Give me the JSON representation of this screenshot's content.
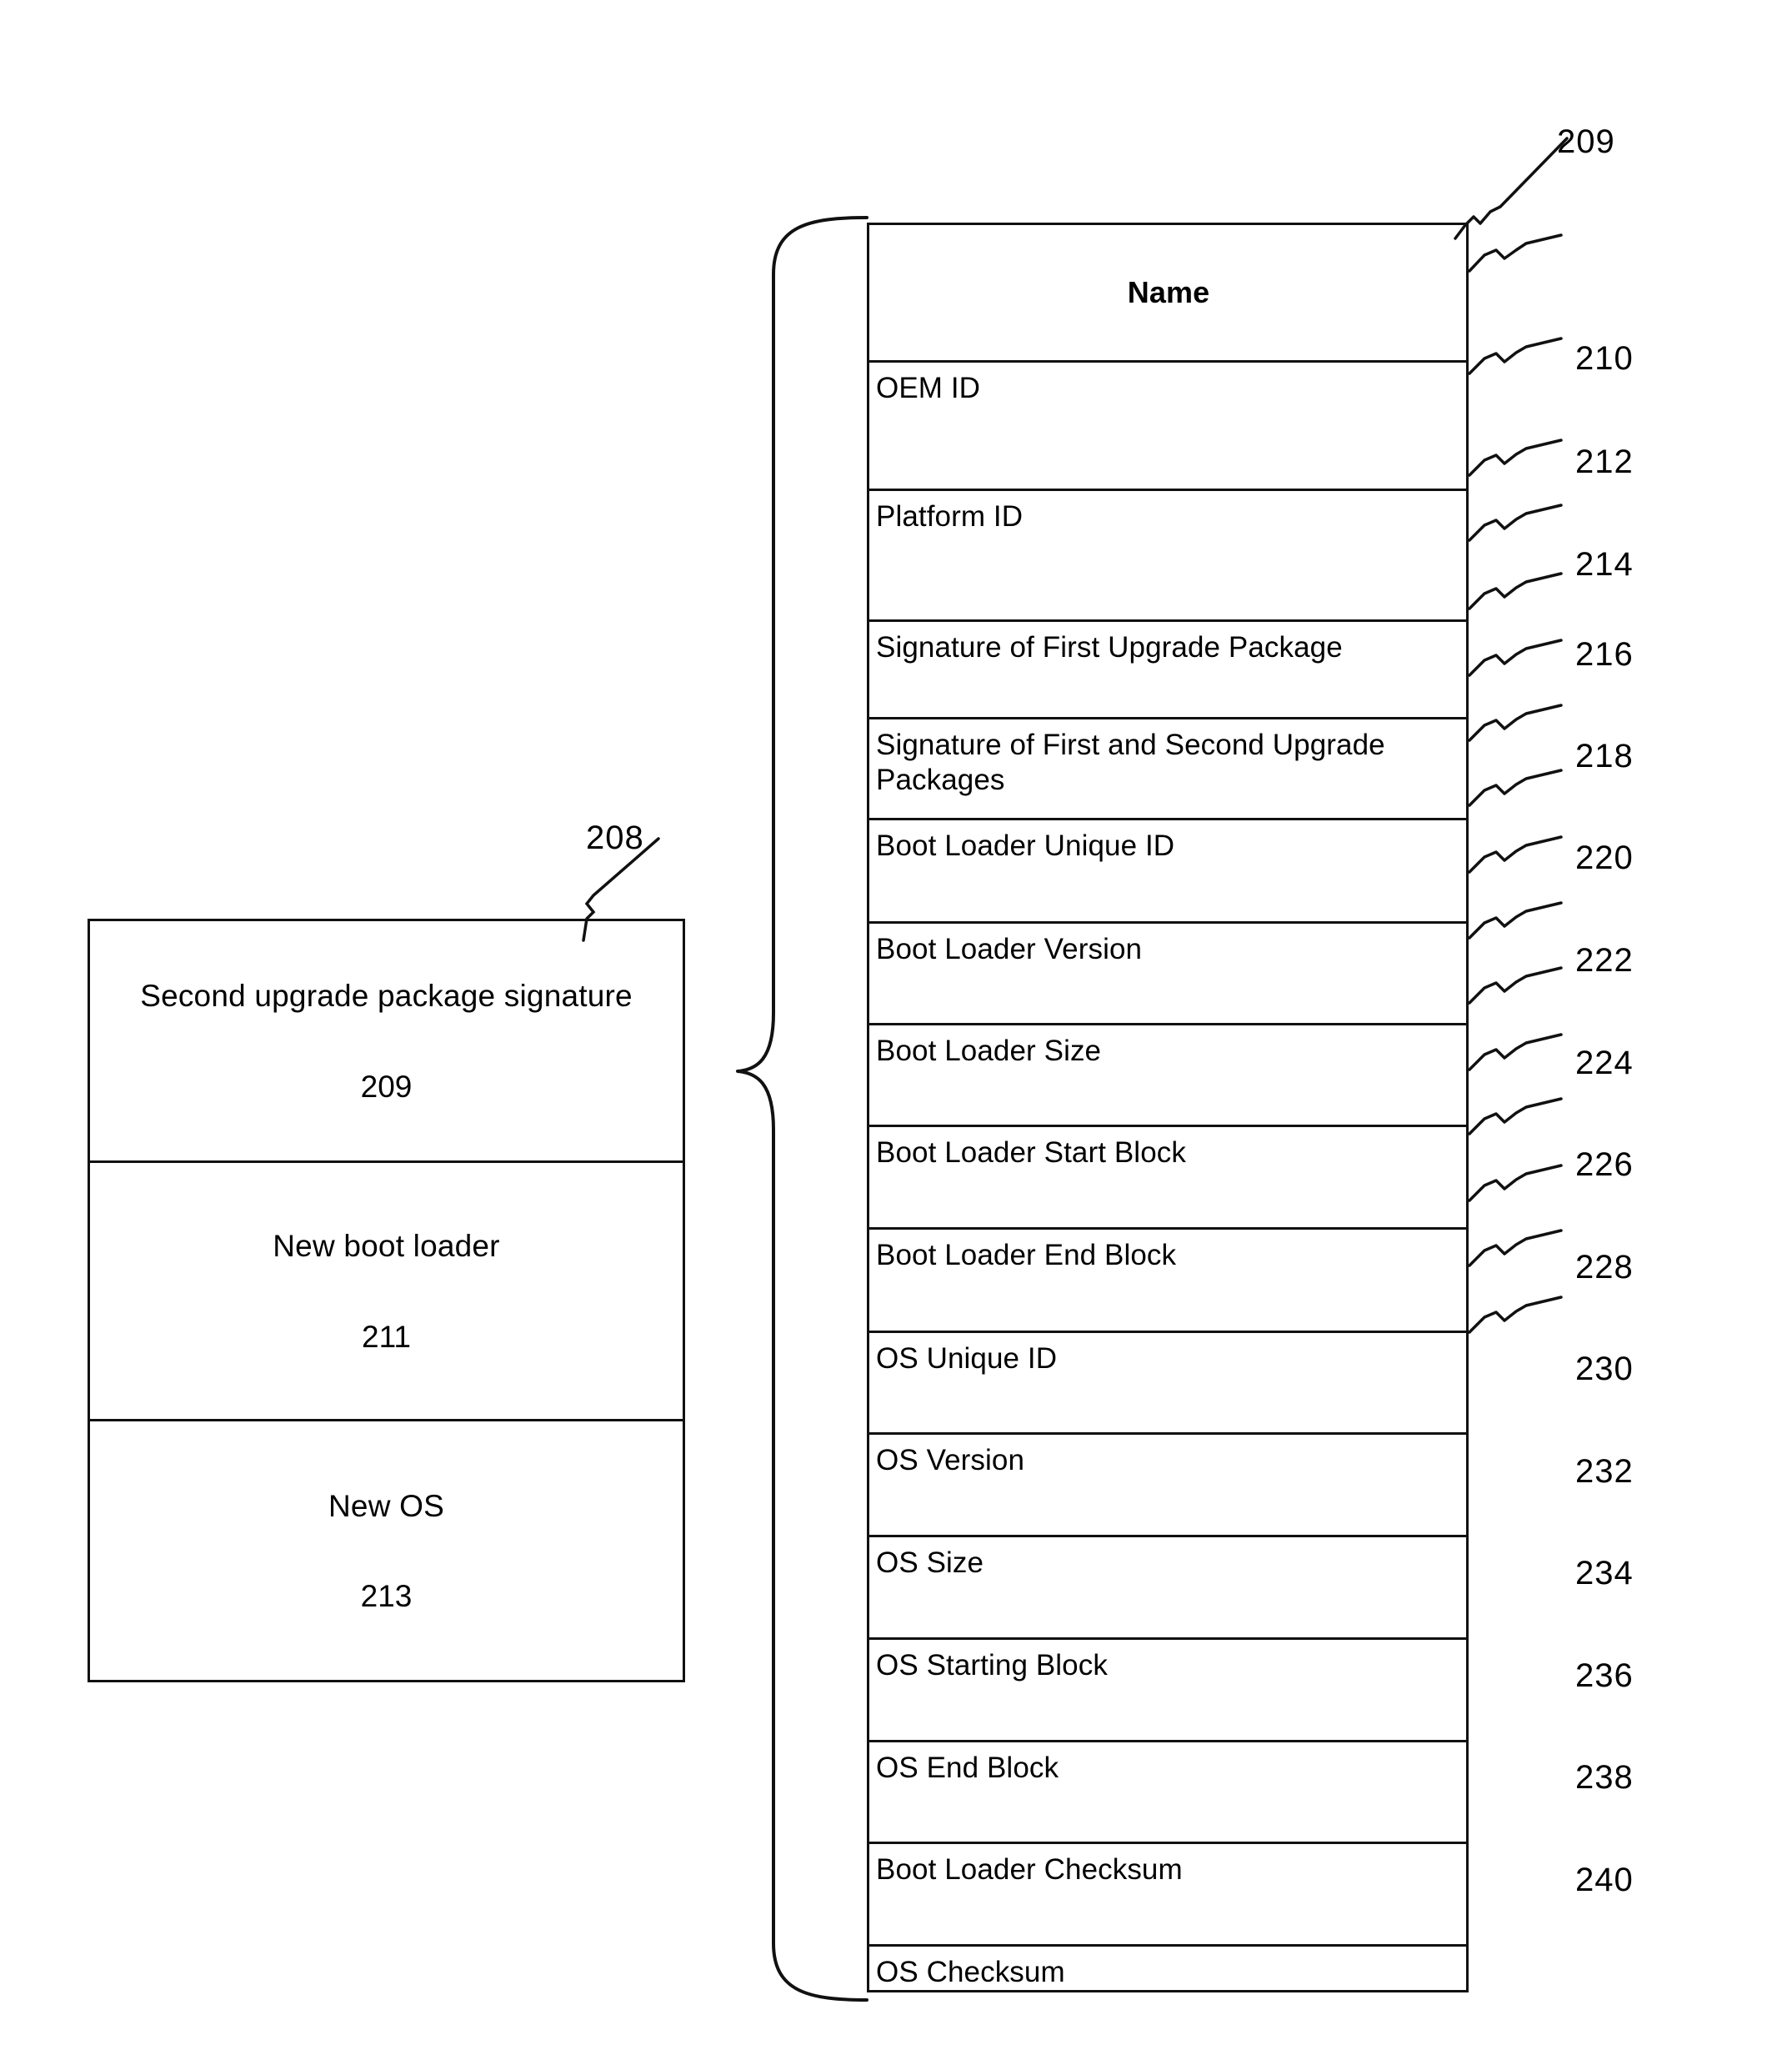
{
  "figure": {
    "package_box": {
      "ref": "208",
      "cells": [
        {
          "title": "Second upgrade package signature",
          "ref": "209"
        },
        {
          "title": "New boot loader",
          "ref": "211"
        },
        {
          "title": "New OS",
          "ref": "213"
        }
      ]
    },
    "metadata_table": {
      "ref": "209",
      "header": "Name",
      "rows": [
        {
          "name": "OEM ID",
          "ref": "210"
        },
        {
          "name": "Platform ID",
          "ref": "212"
        },
        {
          "name": "Signature of First Upgrade Package",
          "ref": "214"
        },
        {
          "name": "Signature of First and Second Upgrade Packages",
          "ref": "216"
        },
        {
          "name": "Boot Loader Unique ID",
          "ref": "218"
        },
        {
          "name": "Boot Loader Version",
          "ref": "220"
        },
        {
          "name": "Boot Loader Size",
          "ref": "222"
        },
        {
          "name": "Boot Loader Start Block",
          "ref": "224"
        },
        {
          "name": "Boot Loader End Block",
          "ref": "226"
        },
        {
          "name": "OS Unique ID",
          "ref": "228"
        },
        {
          "name": "OS Version",
          "ref": "230"
        },
        {
          "name": "OS Size",
          "ref": "232"
        },
        {
          "name": "OS Starting Block",
          "ref": "234"
        },
        {
          "name": "OS End Block",
          "ref": "236"
        },
        {
          "name": "Boot Loader Checksum",
          "ref": "238"
        },
        {
          "name": "OS Checksum",
          "ref": "240"
        }
      ]
    },
    "colors": {
      "line": "#111111",
      "background": "#ffffff",
      "text": "#000000"
    }
  }
}
